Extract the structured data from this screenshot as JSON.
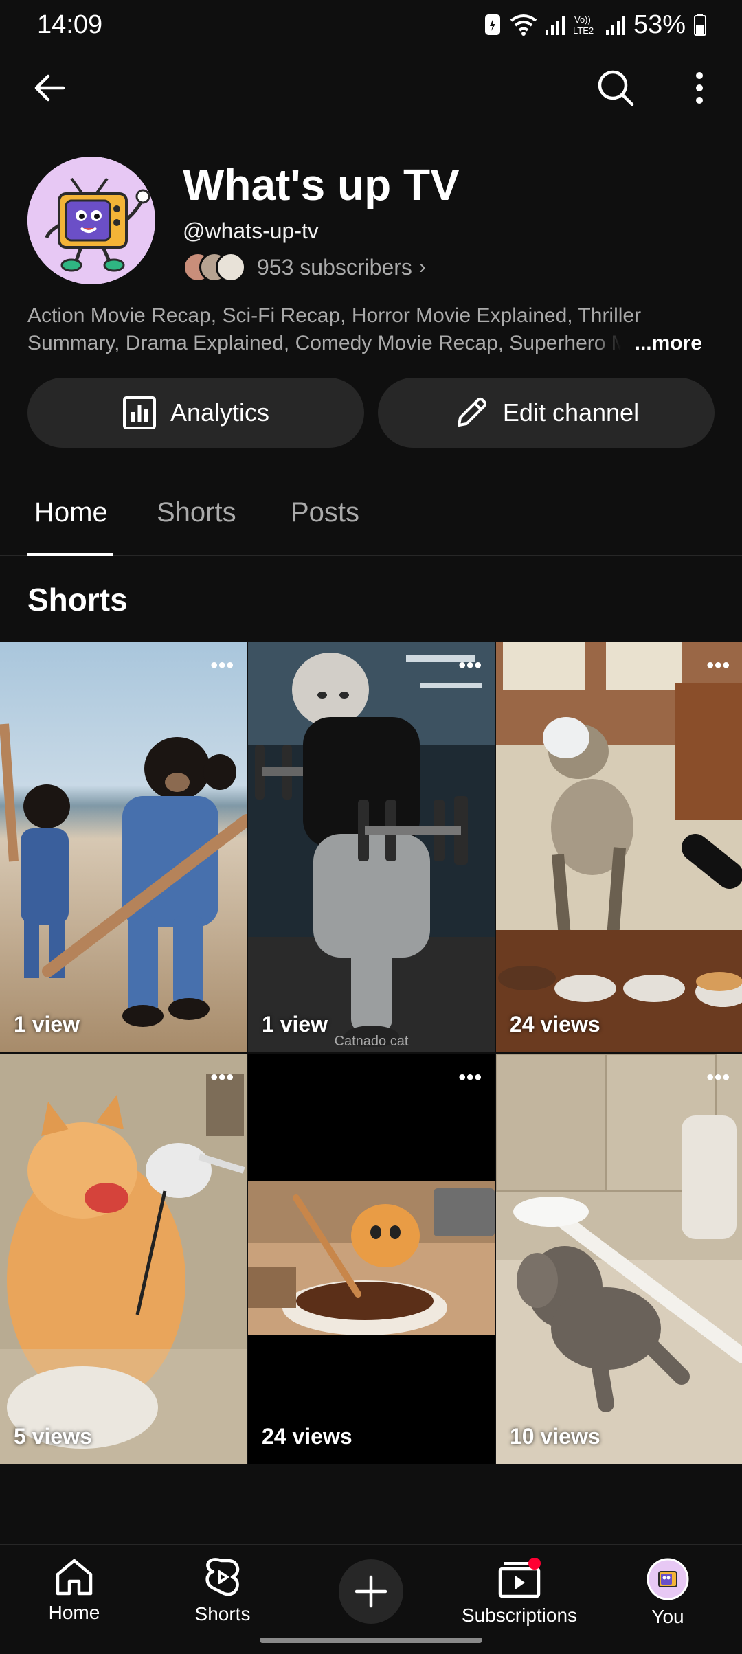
{
  "status_bar": {
    "time": "14:09",
    "battery": "53%"
  },
  "channel": {
    "name": "What's up TV",
    "handle": "@whats-up-tv",
    "subscribers": "953 subscribers",
    "description_line1": "Action Movie Recap, Sci-Fi Recap, Horror Movie Explained, Thriller",
    "description_line2": "Summary, Drama Explained, Comedy Movie Recap, Superhero M",
    "more_label": "...more"
  },
  "actions": {
    "analytics": "Analytics",
    "edit_channel": "Edit channel"
  },
  "tabs": [
    {
      "label": "Home",
      "active": true
    },
    {
      "label": "Shorts",
      "active": false
    },
    {
      "label": "Posts",
      "active": false
    }
  ],
  "section_title": "Shorts",
  "shorts": [
    {
      "views": "1 view",
      "icon": "bears-running-thumbnail"
    },
    {
      "views": "1 view",
      "icon": "cat-lifting-weights-thumbnail",
      "watermark": "Catnado cat"
    },
    {
      "views": "24 views",
      "icon": "cat-drinking-tea-thumbnail"
    },
    {
      "views": "5 views",
      "icon": "cat-biting-lamp-thumbnail"
    },
    {
      "views": "24 views",
      "icon": "kitten-stirring-chocolate-thumbnail"
    },
    {
      "views": "10 views",
      "icon": "baby-elephant-toothbrush-thumbnail"
    }
  ],
  "bottom_nav": {
    "home": "Home",
    "shorts": "Shorts",
    "subscriptions": "Subscriptions",
    "you": "You"
  },
  "colors": {
    "background": "#0f0f0f",
    "surface": "#272727",
    "text_secondary": "#aaaaaa",
    "notification_dot": "#ff0033",
    "avatar_bg": "#e7c8f4"
  }
}
